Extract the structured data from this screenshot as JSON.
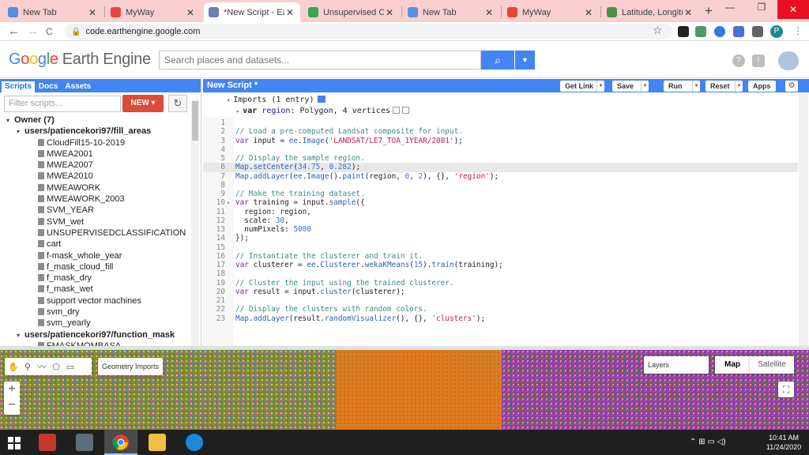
{
  "browser": {
    "tabs": [
      {
        "label": "New Tab",
        "favicon_color": "#5b8fd8"
      },
      {
        "label": "MyWay",
        "favicon_color": "#e8453c"
      },
      {
        "label": "*New Script - Earth",
        "favicon_color": "#6d7fb3"
      },
      {
        "label": "Unsupervised Class",
        "favicon_color": "#34a853"
      },
      {
        "label": "New Tab",
        "favicon_color": "#5b8fd8"
      },
      {
        "label": "MyWay",
        "favicon_color": "#e8453c"
      },
      {
        "label": "Latitude, Longitude",
        "favicon_color": "#4a8f4a"
      }
    ],
    "new_tab_symbol": "+",
    "window_controls": {
      "minimize": "—",
      "restore": "❐",
      "close": "✕"
    },
    "nav": {
      "back": "←",
      "forward": "→",
      "reload": "C"
    },
    "url": "code.earthengine.google.com",
    "profile_initial": "P",
    "star": "☆"
  },
  "gee": {
    "logo": {
      "g": "G",
      "o1": "o",
      "o2": "o",
      "g2": "g",
      "l": "l",
      "e": "e",
      "product": "Earth Engine"
    },
    "search_placeholder": "Search places and datasets...",
    "search_icon": "⌕",
    "help_icon": "?",
    "notif_icon": "!"
  },
  "left_panel": {
    "tabs": [
      "Scripts",
      "Docs",
      "Assets"
    ],
    "filter_placeholder": "Filter scripts...",
    "new_button": "NEW ▾",
    "refresh": "↻",
    "tree": [
      {
        "label": "Owner (7)",
        "level": 0,
        "toggle": "▾",
        "bold": true
      },
      {
        "label": "users/patiencekori97/fill_areas",
        "level": 1,
        "toggle": "▾",
        "bold": true
      },
      {
        "label": "CloudFill15-10-2019",
        "level": 2,
        "file": true
      },
      {
        "label": "MWEA2001",
        "level": 2,
        "file": true
      },
      {
        "label": "MWEA2007",
        "level": 2,
        "file": true
      },
      {
        "label": "MWEA2010",
        "level": 2,
        "file": true
      },
      {
        "label": "MWEAWORK",
        "level": 2,
        "file": true
      },
      {
        "label": "MWEAWORK_2003",
        "level": 2,
        "file": true
      },
      {
        "label": "SVM_YEAR",
        "level": 2,
        "file": true
      },
      {
        "label": "SVM_wet",
        "level": 2,
        "file": true
      },
      {
        "label": "UNSUPERVISEDCLASSIFICATION",
        "level": 2,
        "file": true
      },
      {
        "label": "cart",
        "level": 2,
        "file": true
      },
      {
        "label": "f-mask_whole_year",
        "level": 2,
        "file": true
      },
      {
        "label": "f_mask_cloud_fill",
        "level": 2,
        "file": true
      },
      {
        "label": "f_mask_dry",
        "level": 2,
        "file": true
      },
      {
        "label": "f_mask_wet",
        "level": 2,
        "file": true
      },
      {
        "label": "support vector machines",
        "level": 2,
        "file": true
      },
      {
        "label": "svm_dry",
        "level": 2,
        "file": true
      },
      {
        "label": "svm_yearly",
        "level": 2,
        "file": true
      },
      {
        "label": "users/patiencekori97/function_mask",
        "level": 1,
        "toggle": "▾",
        "bold": true
      },
      {
        "label": "FMASKMOMBASA",
        "level": 2,
        "file": true
      }
    ]
  },
  "editor": {
    "title": "New Script *",
    "buttons": {
      "get_link": "Get Link",
      "save": "Save",
      "run": "Run",
      "reset": "Reset",
      "apps": "Apps"
    },
    "gear": "⚙",
    "imports_header": "Imports (1 entry)",
    "import_var_kw": "var",
    "import_var_name": "region",
    "import_var_rest": ": Polygon, 4 vertices",
    "lines": [
      "",
      "// Load a pre-computed Landsat composite for input.",
      "var input = ee.Image('LANDSAT/LE7_TOA_1YEAR/2001');",
      "",
      "// Display the sample region.",
      "Map.setCenter(34.75, 0.282);",
      "Map.addLayer(ee.Image().paint(region, 0, 2), {}, 'region');",
      "",
      "// Make the training dataset.",
      "var training = input.sample({",
      "  region: region,",
      "  scale: 30,",
      "  numPixels: 5000",
      "});",
      "",
      "// Instantiate the clusterer and train it.",
      "var clusterer = ee.Clusterer.wekaKMeans(15).train(training);",
      "",
      "// Cluster the input using the trained clusterer.",
      "var result = input.cluster(clusterer);",
      "",
      "// Display the clusters with random colors.",
      "Map.addLayer(result.randomVisualizer(), {}, 'clusters');"
    ],
    "highlight_line": 6,
    "fold_line": 10
  },
  "map": {
    "geometry_imports": "Geometry Imports",
    "layers": "Layers",
    "map_type": "Map",
    "satellite_type": "Satellite",
    "zoom_in": "+",
    "zoom_out": "−",
    "fullscreen": "⛶",
    "tools": [
      "✋",
      "⚲",
      "〰",
      "⬠",
      "▭"
    ]
  },
  "taskbar": {
    "time": "10:41 AM",
    "date": "11/24/2020",
    "tray": "⌃ ⊞ ▭ ◁)"
  },
  "colors": {
    "gee_blue": "#4285f4",
    "new_button_red": "#dd4b39",
    "chrome_tabstrip": "#f9cfd0"
  }
}
